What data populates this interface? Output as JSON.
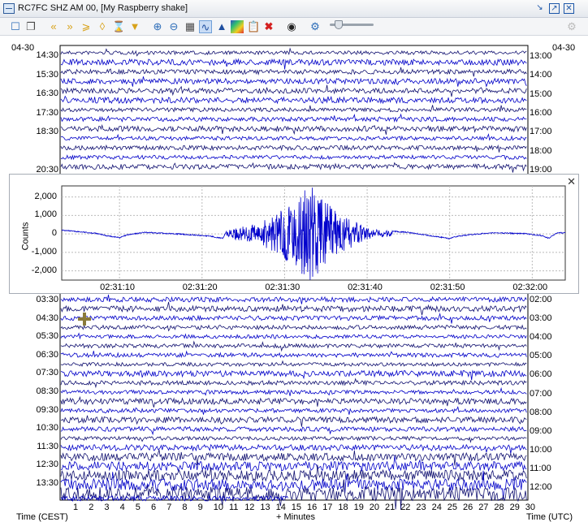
{
  "window": {
    "title": "RC7FC SHZ AM 00, [My Raspberry shake]"
  },
  "toolbar": {
    "icons": [
      "new-icon",
      "copy-icon",
      "scroll-left-fast-icon",
      "scroll-right-fast-icon",
      "hourglass-icon",
      "compress-icon",
      "expand-icon",
      "filter-icon",
      "zoom-in-icon",
      "zoom-out-icon",
      "fit-icon",
      "waveform-icon",
      "spectrum-icon",
      "spectrogram-icon",
      "clipboard-icon",
      "delete-icon",
      "camera-icon",
      "settings-icon"
    ]
  },
  "helicorder": {
    "date_left": "04-30",
    "date_right": "04-30",
    "left_times_top": [
      "14:30",
      "15:30",
      "16:30",
      "17:30",
      "18:30",
      "20:30"
    ],
    "right_times_top": [
      "13:00",
      "14:00",
      "15:00",
      "16:00",
      "17:00",
      "18:00",
      "19:00"
    ],
    "left_times_bottom": [
      "03:30",
      "04:30",
      "05:30",
      "06:30",
      "07:30",
      "08:30",
      "09:30",
      "10:30",
      "11:30",
      "12:30",
      "13:30"
    ],
    "right_times_bottom": [
      "02:00",
      "03:00",
      "04:00",
      "05:00",
      "06:00",
      "07:00",
      "08:00",
      "09:00",
      "10:00",
      "11:00",
      "12:00"
    ],
    "minute_ticks": [
      "1",
      "2",
      "3",
      "4",
      "5",
      "6",
      "7",
      "8",
      "9",
      "10",
      "11",
      "12",
      "13",
      "14",
      "15",
      "16",
      "17",
      "18",
      "19",
      "20",
      "21",
      "22",
      "23",
      "24",
      "25",
      "26",
      "27",
      "28",
      "29",
      "30"
    ],
    "footer_left": "Time (CEST)",
    "footer_center": "+ Minutes",
    "footer_right": "Time (UTC)",
    "trace_colors": [
      "#101070",
      "#0000c8"
    ]
  },
  "chart_data": {
    "type": "line",
    "title": "",
    "xlabel": "",
    "ylabel": "Counts",
    "ylim": [
      -2500,
      2600
    ],
    "yticks": [
      "2,000",
      "1,000",
      "0",
      "-1,000",
      "-2,000"
    ],
    "ytick_values": [
      2000,
      1000,
      0,
      -1000,
      -2000
    ],
    "xticks": [
      "02:31:10",
      "02:31:20",
      "02:31:30",
      "02:31:40",
      "02:31:50",
      "02:32:00"
    ],
    "x_start": "02:31:03",
    "x_end": "02:32:04",
    "grid": true,
    "series": [
      {
        "color": "#0000cc",
        "points": [
          [
            0,
            200
          ],
          [
            2,
            120
          ],
          [
            4,
            40
          ],
          [
            5.5,
            -100
          ],
          [
            7,
            -200
          ],
          [
            8,
            -50
          ],
          [
            10,
            80
          ],
          [
            12,
            40
          ],
          [
            14,
            0
          ],
          [
            16,
            -60
          ],
          [
            18,
            -120
          ],
          [
            19.5,
            -250
          ],
          [
            20,
            180
          ],
          [
            21,
            300
          ],
          [
            22,
            420
          ],
          [
            23,
            480
          ],
          [
            24,
            560
          ],
          [
            25,
            900
          ],
          [
            26,
            1100
          ],
          [
            27,
            1500
          ],
          [
            28,
            1500
          ],
          [
            29,
            2200
          ],
          [
            30,
            2600
          ],
          [
            31,
            2500
          ],
          [
            32,
            1800
          ],
          [
            33,
            1300
          ],
          [
            34,
            1000
          ],
          [
            35,
            900
          ],
          [
            36,
            600
          ],
          [
            37,
            350
          ],
          [
            38,
            250
          ],
          [
            40,
            150
          ],
          [
            42,
            80
          ],
          [
            44,
            -50
          ],
          [
            46,
            -180
          ],
          [
            47,
            -250
          ],
          [
            48,
            -120
          ],
          [
            50,
            -20
          ],
          [
            52,
            60
          ],
          [
            54,
            40
          ],
          [
            56,
            20
          ],
          [
            58,
            -80
          ],
          [
            59,
            -230
          ],
          [
            60,
            60
          ],
          [
            61,
            60
          ]
        ]
      }
    ]
  }
}
